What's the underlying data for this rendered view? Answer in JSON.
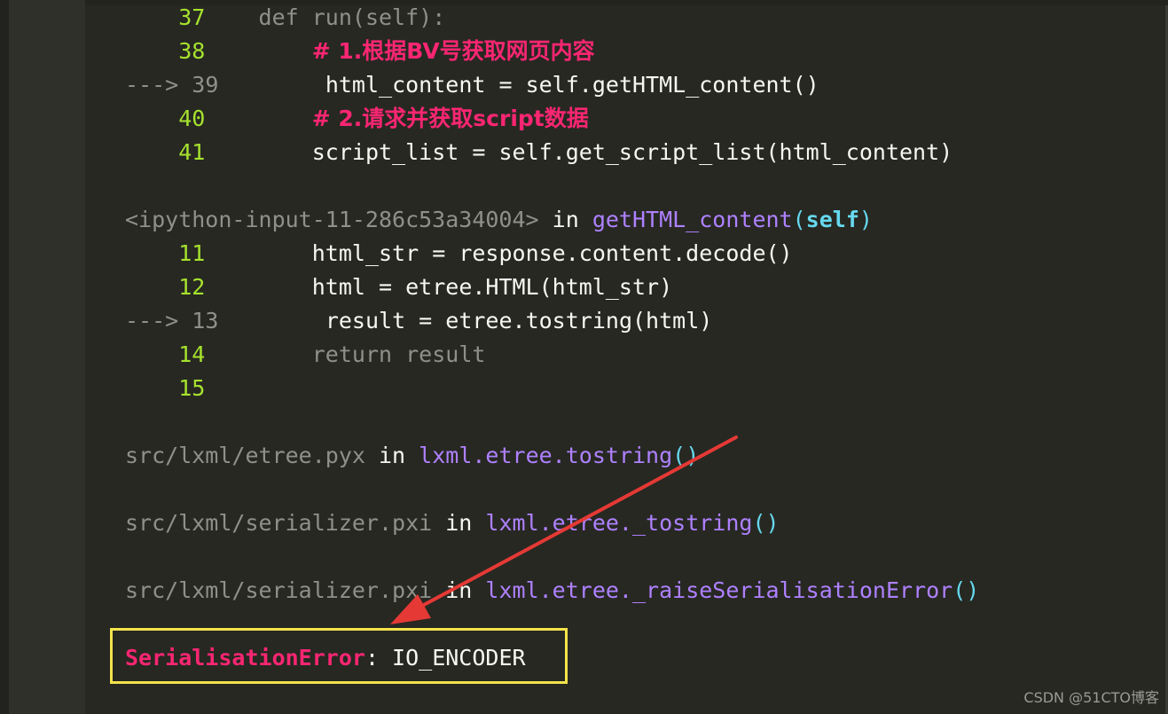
{
  "traceback": {
    "frame1": {
      "lines": [
        {
          "no": "37",
          "code": "def run(self):"
        },
        {
          "no": "38",
          "comment": "# 1.根据BV号获取网页内容"
        },
        {
          "arrow": "--->",
          "no": "39",
          "code": "html_content = self.getHTML_content()"
        },
        {
          "no": "40",
          "comment": "# 2.请求并获取script数据"
        },
        {
          "no": "41",
          "code": "script_list = self.get_script_list(html_content)"
        }
      ]
    },
    "frame2": {
      "header": {
        "path": "<ipython-input-11-286c53a34004>",
        "in_kw": "in",
        "func": "getHTML_content",
        "args": "self"
      },
      "lines": [
        {
          "no": "11",
          "code": "html_str = response.content.decode()"
        },
        {
          "no": "12",
          "code": "html = etree.HTML(html_str)"
        },
        {
          "arrow": "--->",
          "no": "13",
          "code": "result = etree.tostring(html)"
        },
        {
          "no": "14",
          "code": "return result"
        },
        {
          "no": "15",
          "code": ""
        }
      ]
    },
    "frame3": {
      "path": "src/lxml/etree.pyx",
      "in_kw": "in",
      "func": "lxml.etree.tostring"
    },
    "frame4": {
      "path": "src/lxml/serializer.pxi",
      "in_kw": "in",
      "func": "lxml.etree._tostring"
    },
    "frame5": {
      "path": "src/lxml/serializer.pxi",
      "in_kw": "in",
      "func": "lxml.etree._raiseSerialisationError"
    },
    "error": {
      "name": "SerialisationError",
      "message": "IO_ENCODER"
    }
  },
  "watermark": "CSDN @51CTO博客",
  "colors": {
    "background": "#272822",
    "gutter": "#30302a",
    "line_number": "#a6e22e",
    "comment": "#f92672",
    "function": "#ae81ff",
    "error_name": "#f92672",
    "highlight_box": "#f4e34a",
    "annotation_arrow": "#e53935"
  }
}
